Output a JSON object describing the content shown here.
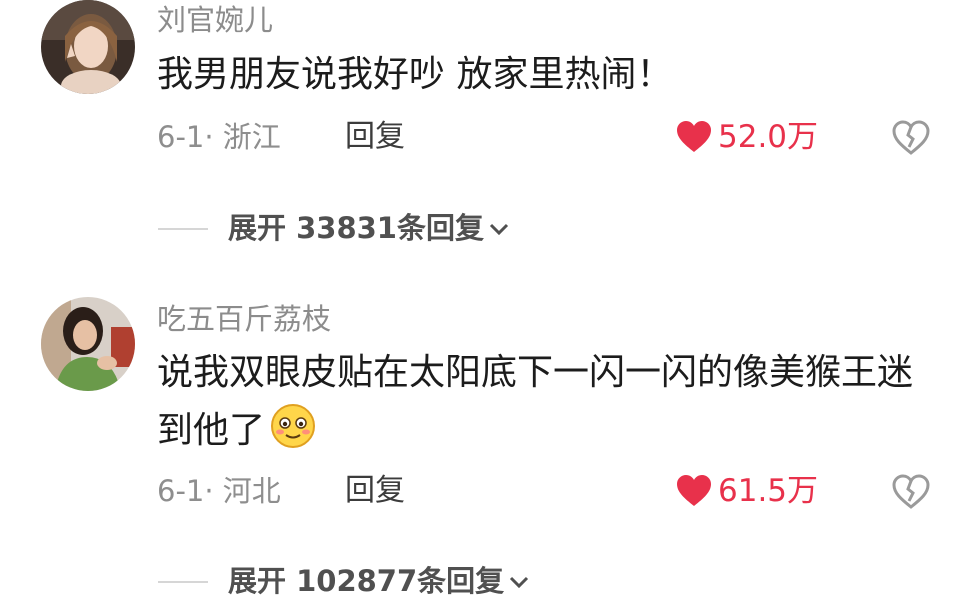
{
  "comments": [
    {
      "username": "刘官婉儿",
      "text": "我男朋友说我好吵 放家里热闹！",
      "meta": "6-1· 浙江",
      "reply_label": "回复",
      "likes": "52.0万",
      "expand_label": "展开 33831条回复"
    },
    {
      "username": "吃五百斤荔枝",
      "text": "说我双眼皮贴在太阳底下一闪一闪的像美猴王迷到他了",
      "emoji": "smiling-blush-emoji",
      "meta": "6-1· 河北",
      "reply_label": "回复",
      "likes": "61.5万",
      "expand_label": "展开 102877条回复"
    }
  ],
  "colors": {
    "like_red": "#e8314b",
    "username_gray": "#8c8c8c",
    "meta_gray": "#8e8e8e",
    "text_dark": "#1c1c1c"
  },
  "icons": [
    "heart-icon",
    "dislike-heart-icon",
    "chevron-down-icon"
  ]
}
